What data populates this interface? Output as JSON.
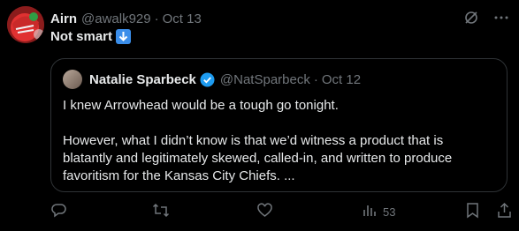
{
  "tweet": {
    "author_name": "Airn",
    "handle": "@awalk929",
    "separator": "·",
    "date": "Oct 13",
    "text": "Not smart"
  },
  "quoted": {
    "author_name": "Natalie Sparbeck",
    "handle": "@NatSparbeck",
    "separator": "·",
    "date": "Oct 12",
    "paragraph1": "I knew Arrowhead would be a tough go tonight.",
    "paragraph2": "However, what I didn’t know is that we’d witness a product that is blatantly and legitimately skewed, called-in, and written to produce favoritism for the Kansas City Chiefs. ..."
  },
  "actions": {
    "views_count": "53"
  },
  "icons": {
    "grok": "grok-icon",
    "more": "more-icon",
    "emoji": "down-arrow-emoji",
    "reply": "reply-icon",
    "retweet": "retweet-icon",
    "like": "like-icon",
    "views": "views-icon",
    "bookmark": "bookmark-icon",
    "share": "share-icon"
  },
  "colors": {
    "background": "#000000",
    "text": "#e7e9ea",
    "muted": "#71767b",
    "border": "#2f3336",
    "verified": "#1d9bf0"
  }
}
